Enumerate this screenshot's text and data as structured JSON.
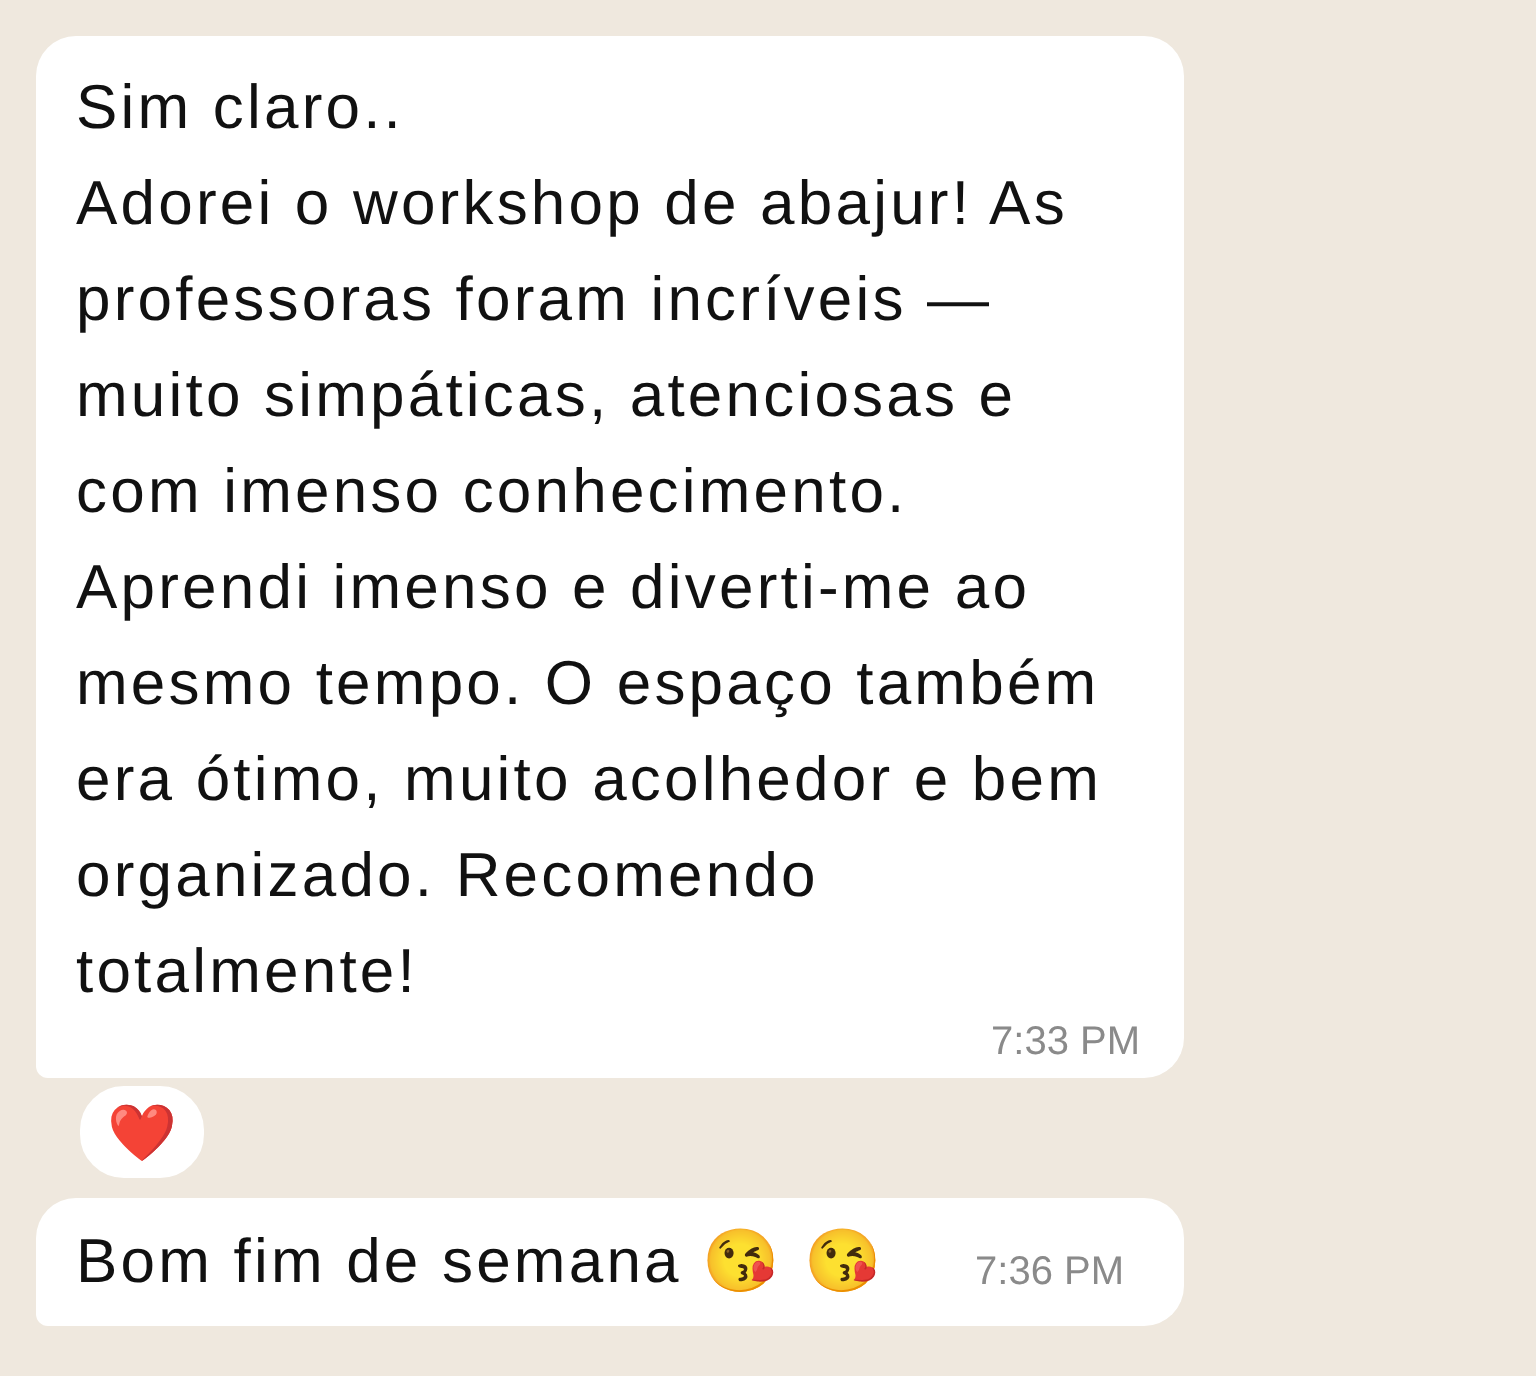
{
  "messages": [
    {
      "kind": "incoming",
      "text": "Sim claro..\nAdorei o workshop de abajur! As professoras foram incríveis — muito simpáticas, atenciosas e com imenso conhecimento. Aprendi imenso e diverti-me ao mesmo tempo. O espaço também era ótimo, muito acolhedor e bem organizado. Recomendo totalmente!",
      "time": "7:33 PM",
      "reaction": "❤️"
    },
    {
      "kind": "incoming",
      "text": "Bom fim de semana 😘 😘",
      "time": "7:36 PM"
    }
  ]
}
